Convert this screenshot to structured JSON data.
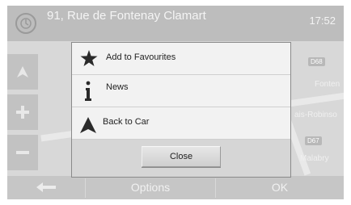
{
  "header": {
    "address": "91, Rue de Fontenay Clamart",
    "time": "17:52"
  },
  "map": {
    "labels": [
      "Fonten",
      "ais-Robinso",
      "Malabry"
    ],
    "shields": [
      "D68",
      "D67"
    ]
  },
  "side_buttons": [
    "up-arrow",
    "zoom-in",
    "zoom-out"
  ],
  "dialog": {
    "items": [
      {
        "label": "Add to Favourites",
        "icon": "star-icon"
      },
      {
        "label": "News",
        "icon": "info-icon"
      },
      {
        "label": "Back to Car",
        "icon": "car-arrow-icon"
      }
    ],
    "close_label": "Close"
  },
  "bottom_bar": {
    "back_icon": "back-arrow-icon",
    "options_label": "Options",
    "ok_label": "OK"
  }
}
